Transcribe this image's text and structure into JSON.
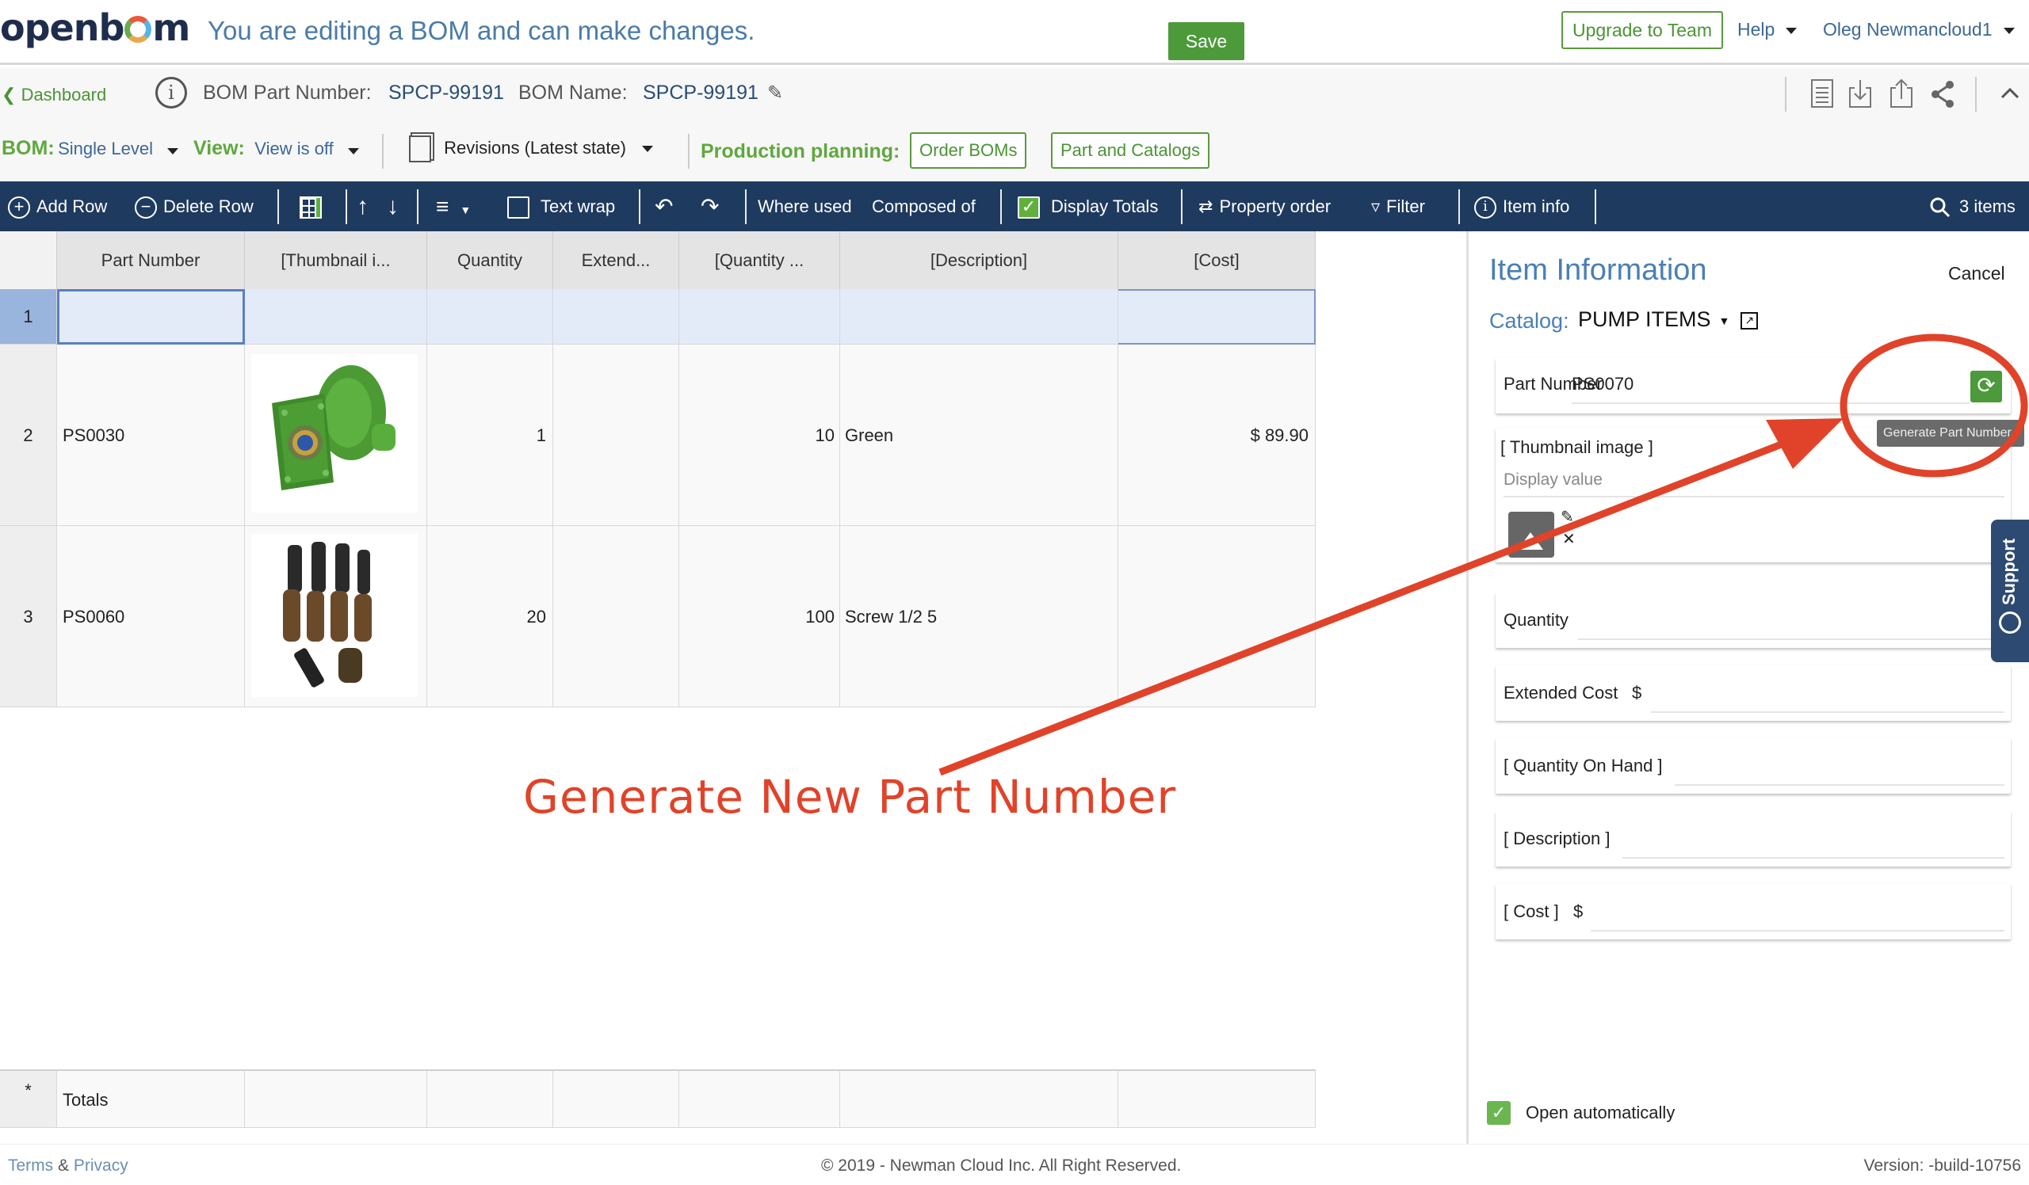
{
  "header": {
    "logo_text": "openbom",
    "edit_message": "You are editing a BOM and can make changes.",
    "upgrade_label": "Upgrade to Team",
    "help_label": "Help",
    "user_name": "Oleg Newmancloud1"
  },
  "breadcrumb": {
    "back_label": "Dashboard",
    "bom_part_number_label": "BOM Part Number:",
    "bom_part_number": "SPCP-99191",
    "bom_name_label": "BOM Name:",
    "bom_name": "SPCP-99191",
    "icons": [
      "report-icon",
      "download-icon",
      "upload-icon",
      "share-icon",
      "collapse-up-icon"
    ]
  },
  "bom_bar": {
    "bom_label": "BOM:",
    "bom_value": "Single Level",
    "view_label": "View:",
    "view_value": "View is off",
    "revisions_label": "Revisions (Latest state)",
    "production_label": "Production planning:",
    "order_boms_label": "Order BOMs",
    "part_catalogs_label": "Part and Catalogs"
  },
  "toolbar": {
    "add_row": "Add Row",
    "delete_row": "Delete Row",
    "text_wrap": "Text wrap",
    "text_wrap_checked": false,
    "where_used": "Where used",
    "composed_of": "Composed of",
    "display_totals": "Display Totals",
    "display_totals_checked": true,
    "property_order": "Property order",
    "filter": "Filter",
    "item_info": "Item info",
    "items_count": "3 items"
  },
  "grid": {
    "columns": [
      "Part Number",
      "[Thumbnail i...",
      "Quantity",
      "Extend...",
      "[Quantity ...",
      "[Description]",
      "[Cost]"
    ],
    "rows": [
      {
        "num": "1",
        "part_number": "",
        "thumbnail": "",
        "quantity": "",
        "extended": "",
        "quantity_on_hand": "",
        "description": "",
        "cost": "",
        "selected": true
      },
      {
        "num": "2",
        "part_number": "PS0030",
        "thumbnail": "green-pump-image",
        "quantity": "1",
        "extended": "",
        "quantity_on_hand": "10",
        "description": "Green",
        "cost": "$ 89.90",
        "selected": false
      },
      {
        "num": "3",
        "part_number": "PS0060",
        "thumbnail": "screws-image",
        "quantity": "20",
        "extended": "",
        "quantity_on_hand": "100",
        "description": "Screw 1/2 5",
        "cost": "",
        "selected": false
      }
    ],
    "totals_marker": "*",
    "totals_label": "Totals"
  },
  "annotation": {
    "text": "Generate New Part Number",
    "color": "#e0432a"
  },
  "item_panel": {
    "title": "Item Information",
    "save_label": "Save",
    "cancel_label": "Cancel",
    "catalog_label": "Catalog:",
    "catalog_value": "PUMP ITEMS",
    "fields": {
      "part_number_label": "Part Number",
      "part_number_value": "PS0070",
      "generate_tooltip": "Generate Part Number",
      "thumbnail_label": "[ Thumbnail image ]",
      "display_value_placeholder": "Display value",
      "quantity_label": "Quantity",
      "extended_cost_label": "Extended Cost",
      "extended_cost_prefix": "$",
      "qoh_label": "[ Quantity On Hand ]",
      "description_label": "[ Description ]",
      "cost_label": "[ Cost ]",
      "cost_prefix": "$"
    },
    "open_automatically_label": "Open automatically",
    "open_automatically_checked": true
  },
  "support_label": "Support",
  "footer": {
    "terms": "Terms",
    "amp": "&",
    "privacy": "Privacy",
    "copyright": "© 2019 - Newman Cloud Inc. All Right Reserved.",
    "version": "Version: -build-10756"
  }
}
